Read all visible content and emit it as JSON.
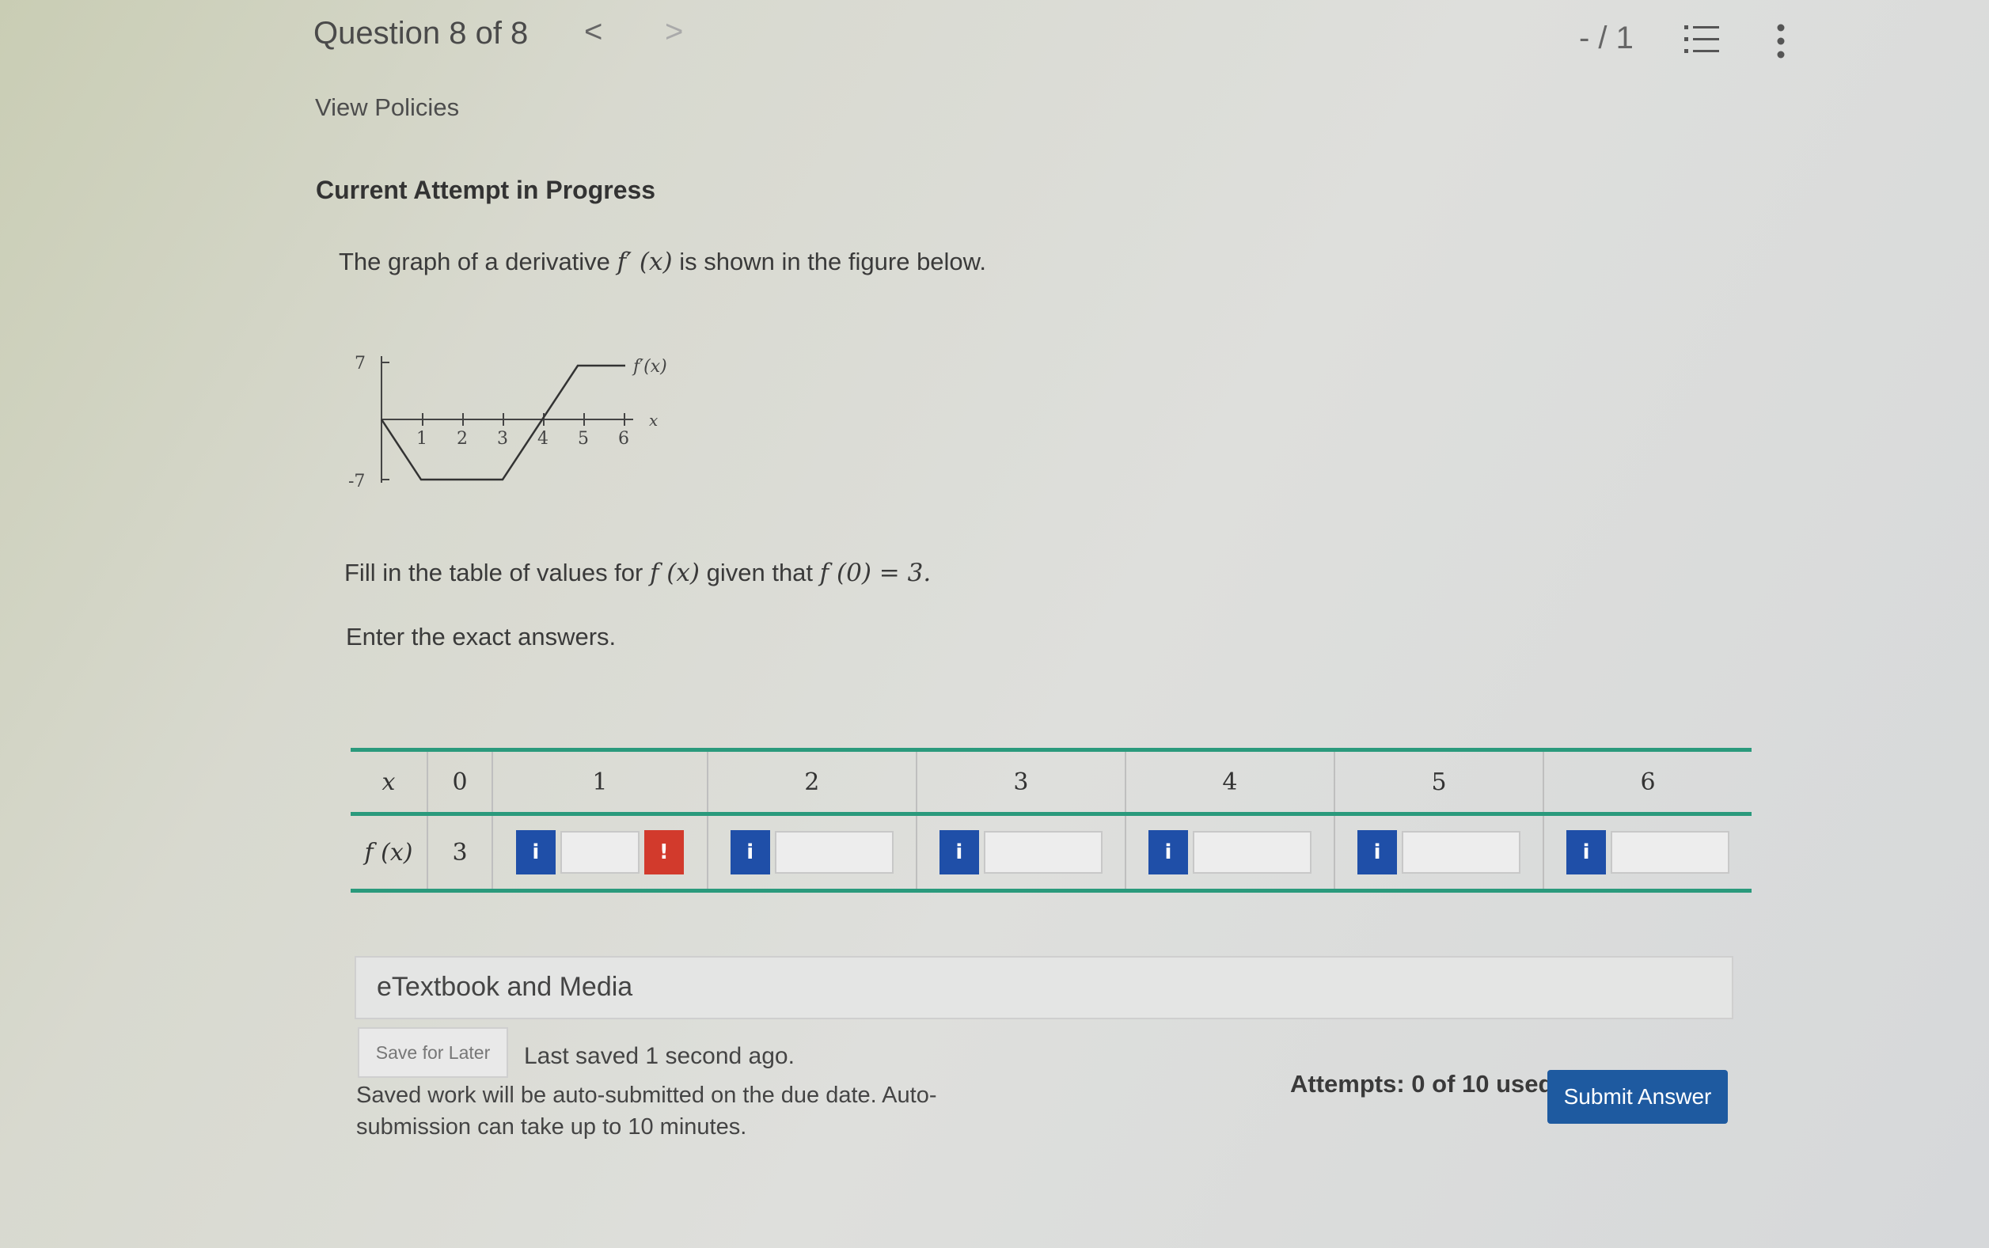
{
  "header": {
    "question_label": "Question 8 of 8",
    "prev_glyph": "<",
    "next_glyph": ">",
    "score": "- / 1",
    "list_icon": "list-icon",
    "more_icon": "more-vertical-icon"
  },
  "policies_link": "View Policies",
  "attempt_heading": "Current Attempt in Progress",
  "question": {
    "intro_a": "The graph of a derivative",
    "intro_fn": "f′ (x)",
    "intro_b": "is shown in the figure below.",
    "fill_a": "Fill in the table of values for",
    "fill_fn": "f (x)",
    "fill_b": "given that",
    "fill_cond": "f (0) = 3.",
    "instruction": "Enter the exact answers."
  },
  "graph": {
    "curve_label": "f′(x)",
    "x_axis_label": "x",
    "y_top": "7",
    "y_bottom": "-7",
    "x_ticks": [
      "1",
      "2",
      "3",
      "4",
      "5",
      "6"
    ]
  },
  "table": {
    "row1_header": "x",
    "row2_header": "f (x)",
    "x_values": [
      "0",
      "1",
      "2",
      "3",
      "4",
      "5",
      "6"
    ],
    "f0_value": "3",
    "info_glyph": "i",
    "error_glyph": "!"
  },
  "media_bar": "eTextbook and Media",
  "save_button": "Save for Later",
  "last_saved": "Last saved 1 second ago.",
  "auto_submit": "Saved work will be auto-submitted on the due date. Auto-submission can take up to 10 minutes.",
  "attempts": "Attempts: 0 of 10 used",
  "submit_button": "Submit Answer",
  "colors": {
    "accent_green": "#2a9a7c",
    "info_blue": "#1f4fa8",
    "error_red": "#d23a2c",
    "submit_blue": "#1e5aa0"
  }
}
